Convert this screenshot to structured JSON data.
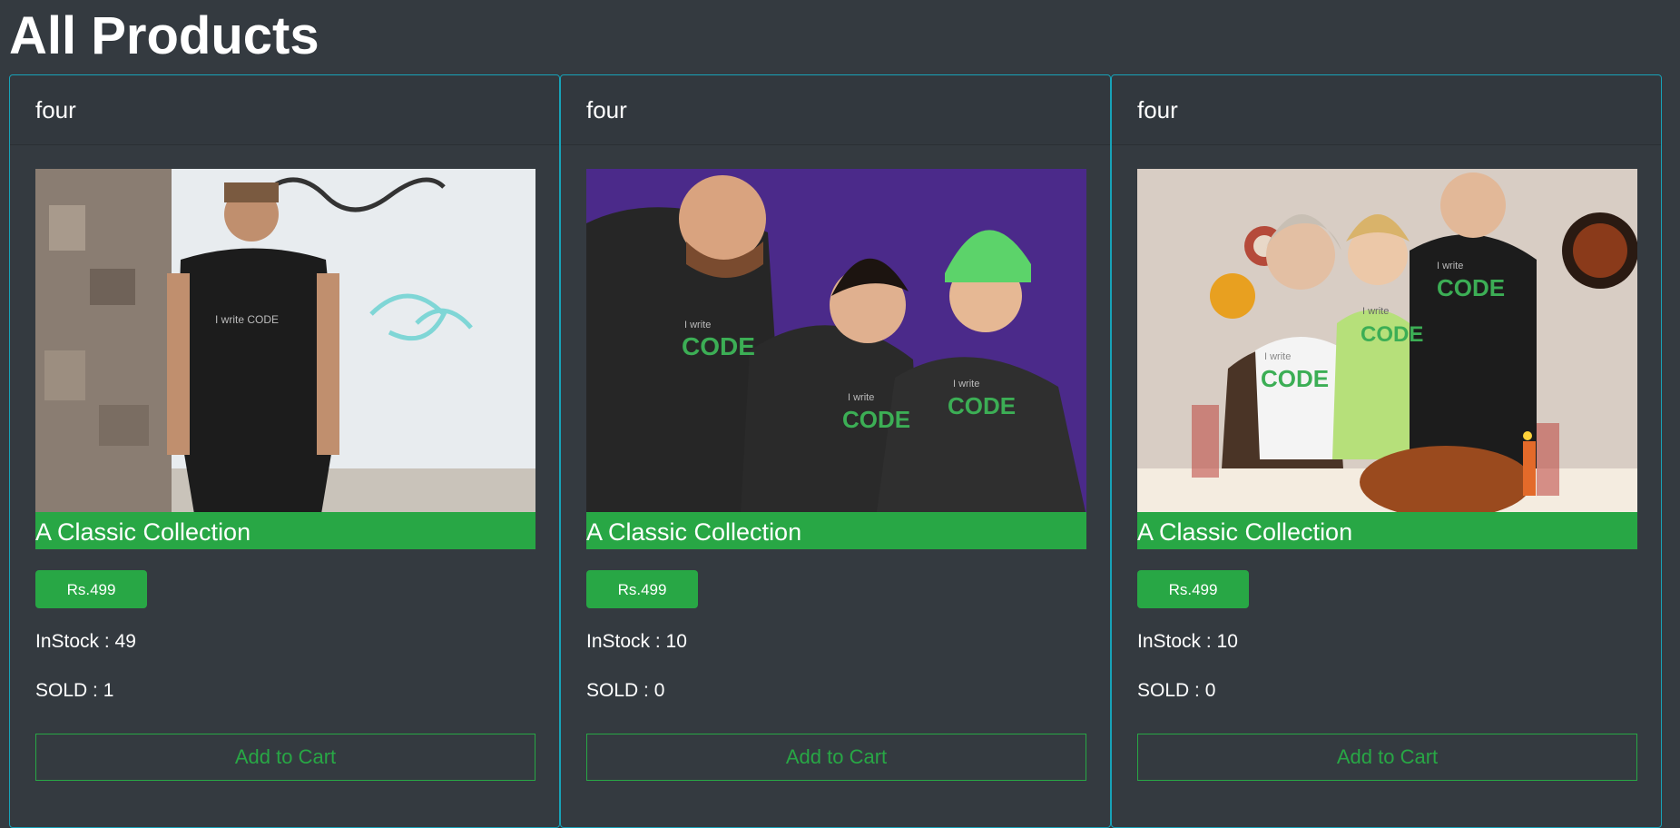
{
  "page": {
    "title": "All Products"
  },
  "products": [
    {
      "header": "four",
      "image": "photo: man wearing black 'I write CODE' t-shirt against graffiti wall",
      "image_text": "I write CODE",
      "name": "A Classic Collection",
      "price": "Rs.499",
      "in_stock": "InStock : 49",
      "sold": "SOLD : 1",
      "add_to_cart": "Add to Cart"
    },
    {
      "header": "four",
      "image": "photo: three friends in black 'I write CODE' hoodies on purple background",
      "image_text": "I write CODE",
      "name": "A Classic Collection",
      "price": "Rs.499",
      "in_stock": "InStock : 10",
      "sold": "SOLD : 0",
      "add_to_cart": "Add to Cart"
    },
    {
      "header": "four",
      "image": "photo: family in 'I write CODE' t-shirts at a holiday dinner table",
      "image_text": "I write CODE",
      "name": "A Classic Collection",
      "price": "Rs.499",
      "in_stock": "InStock : 10",
      "sold": "SOLD : 0",
      "add_to_cart": "Add to Cart"
    }
  ],
  "colors": {
    "background": "#343a40",
    "card_border": "#17a2b8",
    "accent_green": "#28a745",
    "text": "#ffffff"
  }
}
